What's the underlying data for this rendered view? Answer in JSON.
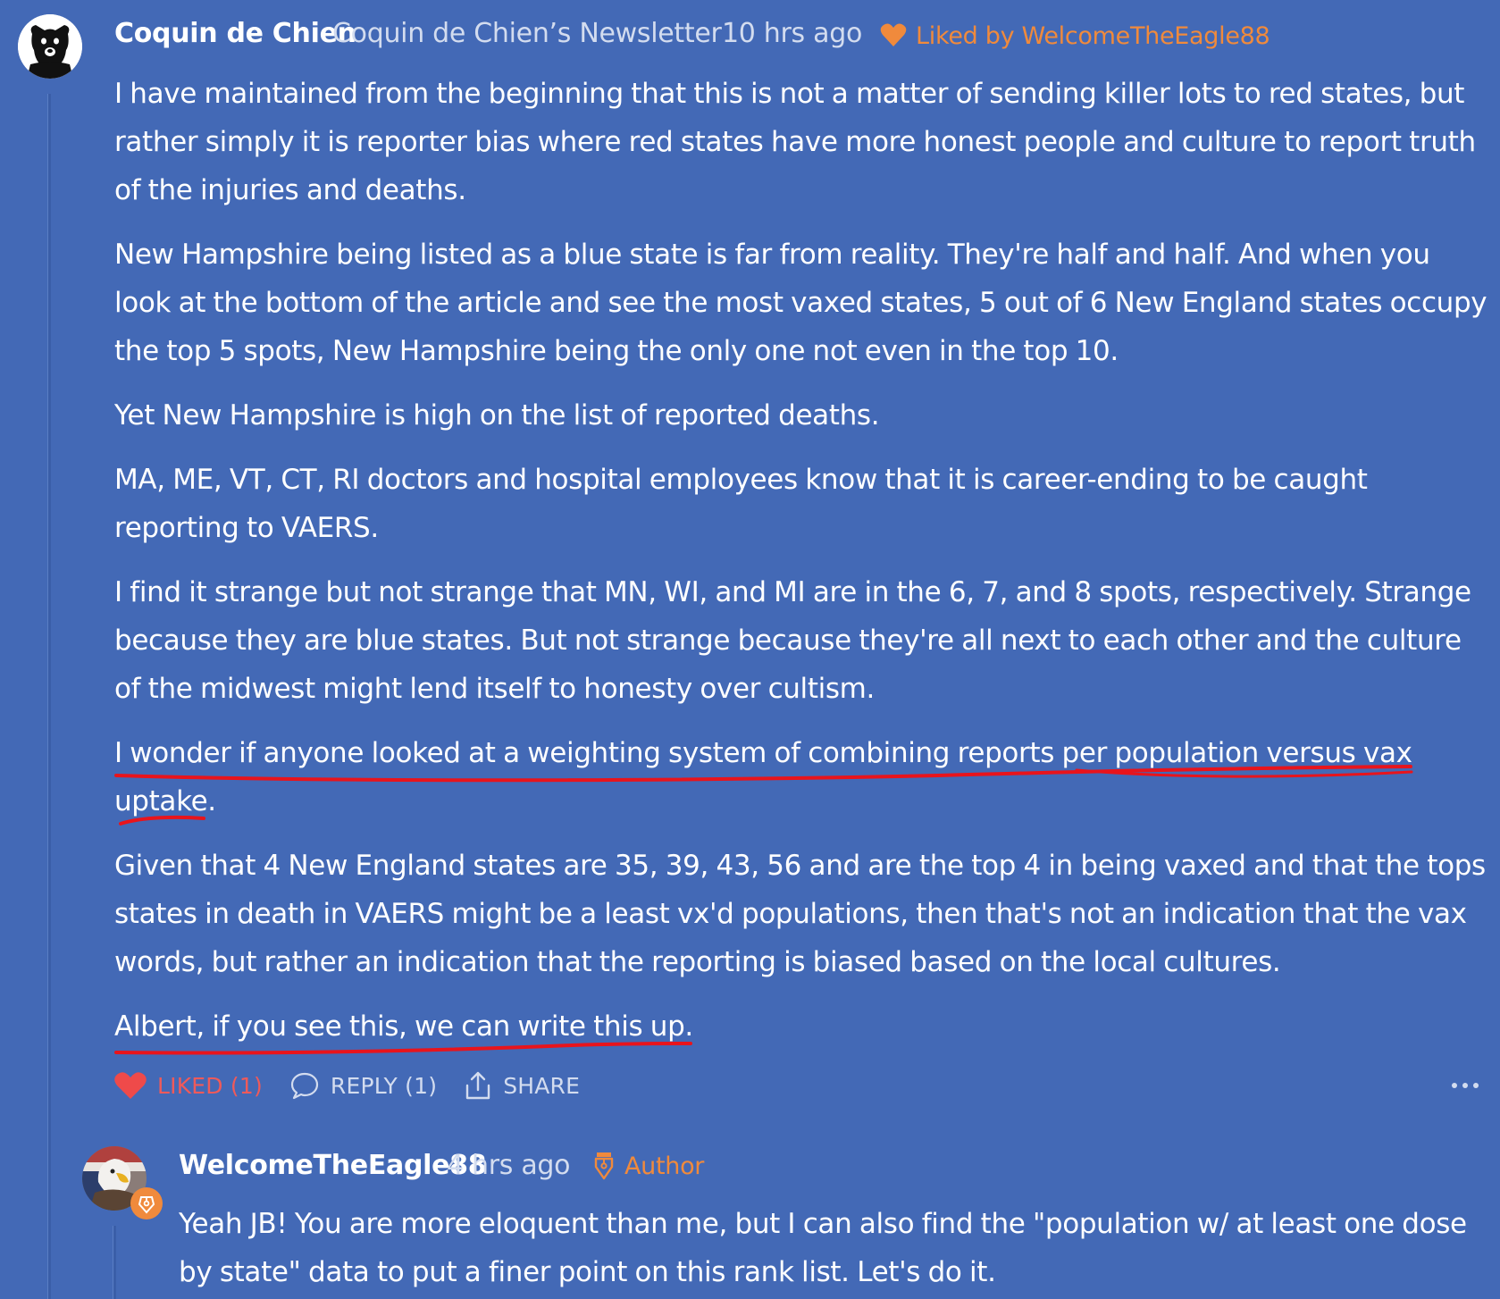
{
  "comment": {
    "author": "Coquin de Chien",
    "publication": "Coquin de Chien’s Newsletter",
    "time": "10 hrs ago",
    "liked_by": "Liked by WelcomeTheEagle88",
    "paragraphs": [
      "I have maintained from the beginning that this is not a matter of sending killer lots to red states, but rather simply it is reporter bias where red states have more honest people and culture to report truth of the injuries and deaths.",
      "New Hampshire being listed as a blue state is far from reality. They're half and half. And when you look at the bottom of the article and see the most vaxed states, 5 out of 6 New England states occupy the top 5 spots, New Hampshire being the only one not even in the top 10.",
      "Yet New Hampshire is high on the list of reported deaths.",
      "MA, ME, VT, CT, RI doctors and hospital employees know that it is career-ending to be caught reporting to VAERS.",
      "I find it strange but not strange that MN, WI, and MI are in the 6, 7, and 8 spots, respectively. Strange because they are blue states. But not strange because they're all next to each other and the culture of the midwest might lend itself to honesty over cultism.",
      "I wonder if anyone looked at a weighting system of combining reports per population versus vax uptake.",
      "Given that 4 New England states are 35, 39, 43, 56 and are the top 4 in being vaxed and that the tops states in death in VAERS might be a least vx'd populations, then that's not an indication that the vax words, but rather an indication that the reporting is biased based on the local cultures.",
      "Albert, if you see this, we can write this up."
    ],
    "actions": {
      "liked": "LIKED (1)",
      "reply": "REPLY (1)",
      "share": "SHARE"
    },
    "more_icon": "ellipsis-icon"
  },
  "reply": {
    "author": "WelcomeTheEagle88",
    "time": "4 hrs ago",
    "badge": "Author",
    "text": "Yeah JB! You are more eloquent than me, but I can also find the \"population w/ at least one dose by state\" data to put a finer point on this rank list. Let's do it."
  },
  "colors": {
    "background": "#4369b6",
    "accent_orange": "#f08a3c",
    "liked_red": "#ef5a5a",
    "muted_text": "#d3dcef",
    "annotation_red": "#e8141c"
  }
}
